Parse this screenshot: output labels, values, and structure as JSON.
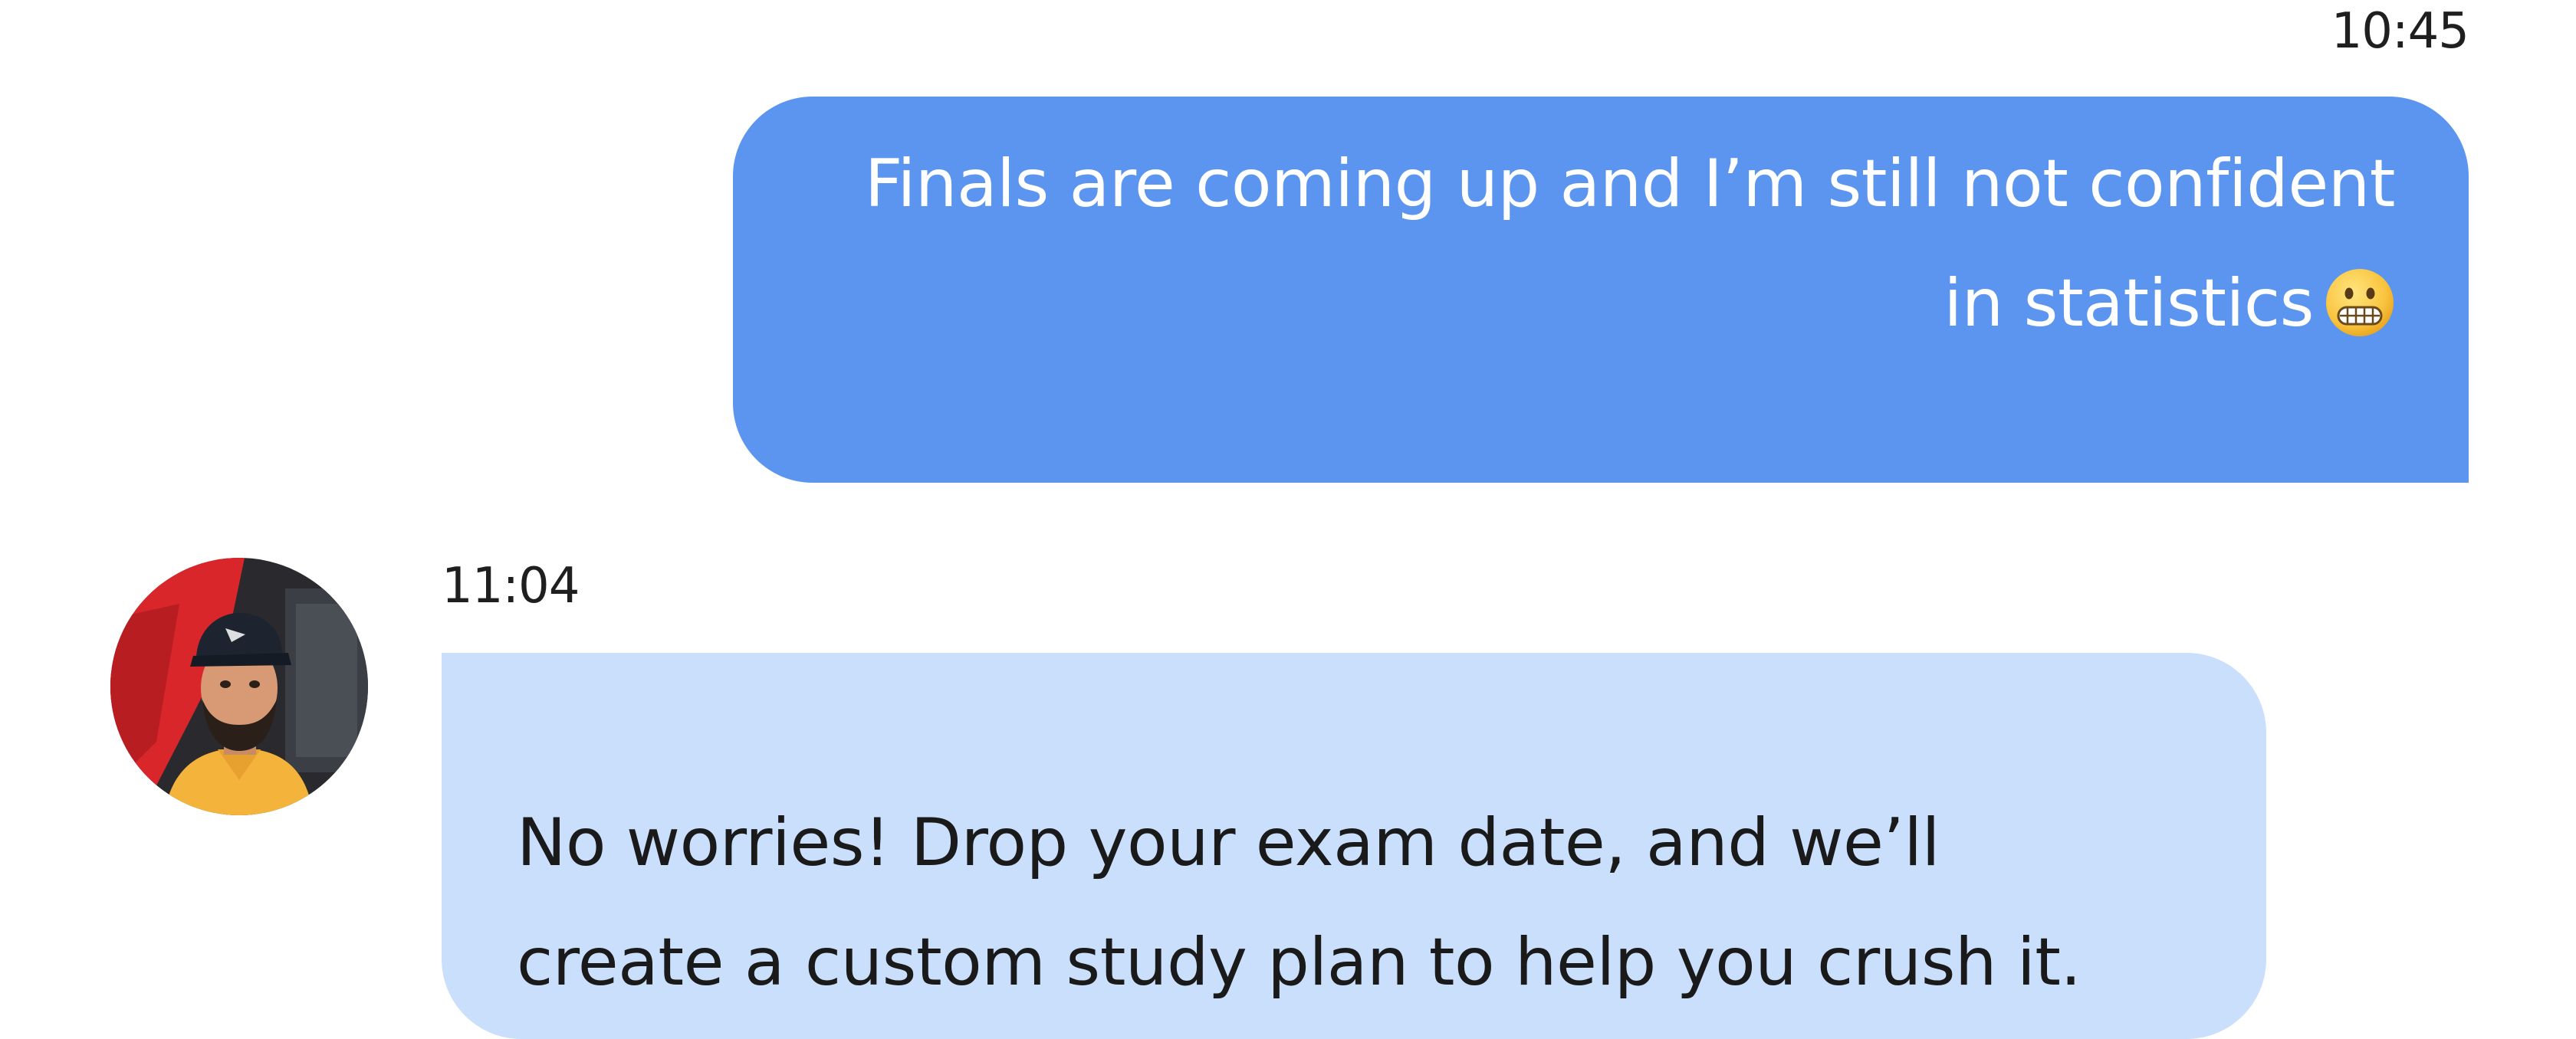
{
  "messages": {
    "outgoing": {
      "time": "10:45",
      "lines": [
        "Finals are coming up and I’m still not confident",
        "in statistics"
      ],
      "emoji": "grimacing-face-icon"
    },
    "incoming": {
      "time": "11:04",
      "avatar": "user-avatar-photo",
      "lines": [
        "No worries! Drop your exam date, and we’ll",
        "create a custom study plan to help you crush it."
      ]
    }
  },
  "colors": {
    "outgoing_bubble": "#5b95ef",
    "incoming_bubble": "#cadffc",
    "outgoing_text": "#ffffff",
    "incoming_text": "#1a1a1a"
  }
}
